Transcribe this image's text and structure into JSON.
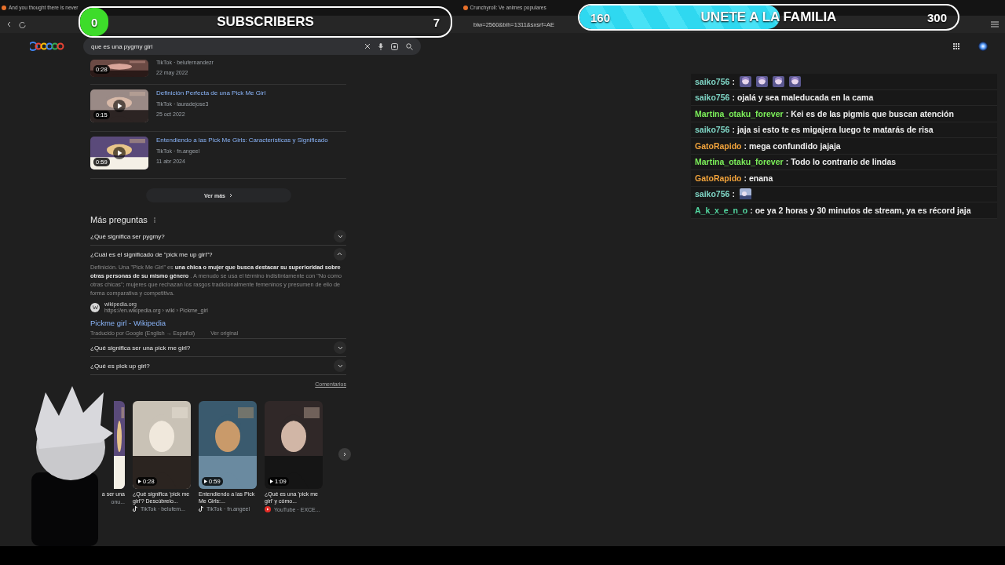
{
  "overlay": {
    "subscribers": {
      "current": "0",
      "label": "SUBSCRIBERS",
      "goal": "7",
      "level": 0
    },
    "goal_bar": {
      "current": "160",
      "label": "UNETE A LA FAMILIA",
      "goal": "300",
      "level": 0.53
    }
  },
  "browser": {
    "tabs": [
      {
        "title": "And you thought there is never"
      },
      {
        "title": "Crunchyroll: Ve animes populares"
      }
    ],
    "address": "biw=2560&bih=1311&sxsrf=AE"
  },
  "search": {
    "query": "que es una pygmy girl"
  },
  "videos": [
    {
      "duration": "0:28",
      "source": "TikTok · belufernandezr",
      "date": "22 may 2022"
    },
    {
      "title": "Definición Perfecta de una Pick Me Girl",
      "duration": "0:15",
      "source": "TikTok · lauradejose3",
      "date": "25 oct 2022"
    },
    {
      "title": "Entendiendo a las Pick Me Girls: Características y Significado",
      "duration": "0:59",
      "source": "TikTok · fn.angeel",
      "date": "11 abr 2024"
    }
  ],
  "more_button": "Ver más",
  "questions": {
    "heading": "Más preguntas",
    "items": [
      {
        "question": "¿Qué significa ser pygmy?",
        "expanded": false
      },
      {
        "question": "¿Cuál es el significado de \"pick me up girl\"?",
        "expanded": true,
        "answer": "Definición. Una \"Pick Me Girl\" es **una chica o mujer que busca destacar su superioridad sobre otras personas de su mismo género** . A menudo se usa el término indistintamente con \"No como otras chicas\"; mujeres que rechazan los rasgos tradicionalmente femeninos y presumen de ello de forma comparativa y competitiva.",
        "source": {
          "site": "wikipedia.org",
          "url": "https://en.wikipedia.org › wiki › Pickme_girl",
          "title": "Pickme girl - Wikipedia",
          "translated": "Traducido por Google (English → Español)",
          "original_link": "Ver original"
        }
      },
      {
        "question": "¿Qué significa ser una pick me girl?",
        "expanded": false
      },
      {
        "question": "¿Qué es pick up girl?",
        "expanded": false
      }
    ]
  },
  "feedback": "Comentarios",
  "short_videos": [
    {
      "title": "a ser una",
      "source": "onu..."
    },
    {
      "title": "¿Qué significa 'pick me girl'? Descúbrelo...",
      "duration": "0:28",
      "kind": "tiktok",
      "source": "TikTok · belufem..."
    },
    {
      "title": "Entendiendo a las Pick Me Girls:...",
      "duration": "0:59",
      "kind": "tiktok",
      "source": "TikTok · fn.angeel"
    },
    {
      "title": "¿Qué es una 'pick me girl' y cómo...",
      "duration": "1:09",
      "kind": "youtube",
      "source": "YouTube · EXCE..."
    }
  ],
  "chat": [
    {
      "user": "saiko756",
      "color": "#7fd6c6",
      "separator": ":",
      "emotes": [
        {
          "kind": "face"
        },
        {
          "kind": "face"
        },
        {
          "kind": "face"
        },
        {
          "kind": "face"
        }
      ]
    },
    {
      "user": "saiko756",
      "color": "#7fd6c6",
      "separator": ":",
      "message": "ojalá y sea maleducada en la cama"
    },
    {
      "user": "Martina_otaku_forever",
      "color": "#7cf05a",
      "separator": ":",
      "message": "Kei es de las pigmis que buscan atención"
    },
    {
      "user": "saiko756",
      "color": "#7fd6c6",
      "separator": ":",
      "message": "jaja si esto te es migajera luego te matarás de risa"
    },
    {
      "user": "GatoRapido",
      "color": "#f0a23b",
      "separator": ":",
      "message": "mega confundido jajaja"
    },
    {
      "user": "Martina_otaku_forever",
      "color": "#7cf05a",
      "separator": ":",
      "message": "Todo lo contrario de lindas"
    },
    {
      "user": "GatoRapido",
      "color": "#f0a23b",
      "separator": ":",
      "message": "enana"
    },
    {
      "user": "saiko756",
      "color": "#7fd6c6",
      "separator": ":",
      "emotes": [
        {
          "kind": "scene"
        }
      ]
    },
    {
      "user": "A_k_x_e_n_o",
      "color": "#52d7a0",
      "separator": ":",
      "message": "oe ya 2 horas y 30 minutos de stream, ya es récord jaja"
    }
  ]
}
